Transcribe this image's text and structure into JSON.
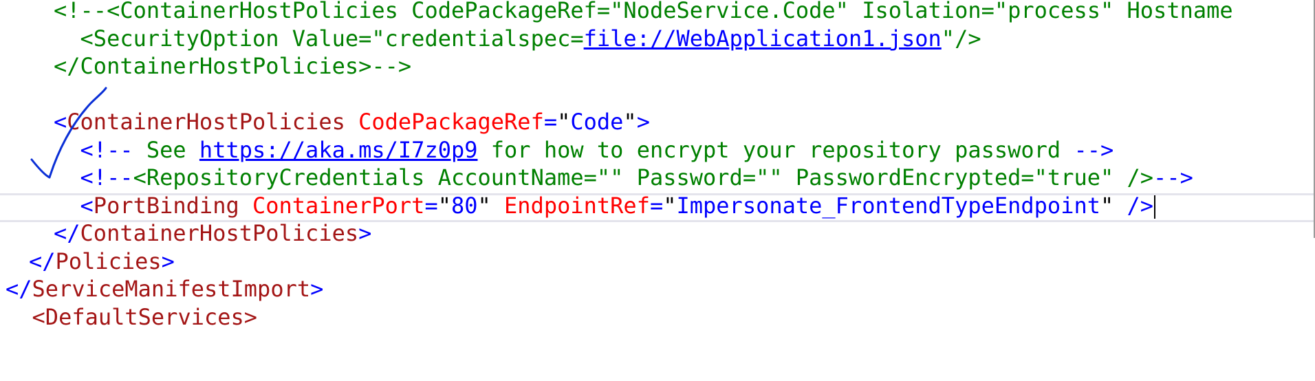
{
  "colors": {
    "delimiter": "#0000ff",
    "tag": "#a31515",
    "attribute": "#ff0000",
    "value": "#0000ff",
    "comment": "#008000",
    "link": "#0000ff",
    "current_line_border": "#e4e4ec",
    "annotation_ink": "#0a2fd6"
  },
  "annotation": {
    "icon": "handwritten-checkmark-icon"
  },
  "lines": [
    {
      "tokens": [
        {
          "t": "comment",
          "v": "<!--<ContainerHostPolicies CodePackageRef=\"NodeService.Code\" Isolation=\"process\" Hostname"
        }
      ]
    },
    {
      "tokens": [
        {
          "t": "comment",
          "v": "  <SecurityOption Value=\"credentialspec="
        },
        {
          "t": "link",
          "v": "file://WebApplication1.json"
        },
        {
          "t": "comment",
          "v": "\"/>"
        }
      ]
    },
    {
      "tokens": [
        {
          "t": "comment",
          "v": "</ContainerHostPolicies>-->"
        }
      ]
    },
    {
      "tokens": []
    },
    {
      "tokens": [
        {
          "t": "delim",
          "v": "<"
        },
        {
          "t": "tag",
          "v": "ContainerHostPolicies"
        },
        {
          "t": "text",
          "v": " "
        },
        {
          "t": "attr",
          "v": "CodePackageRef"
        },
        {
          "t": "eq",
          "v": "="
        },
        {
          "t": "quote",
          "v": "\""
        },
        {
          "t": "val",
          "v": "Code"
        },
        {
          "t": "quote",
          "v": "\""
        },
        {
          "t": "delim",
          "v": ">"
        }
      ]
    },
    {
      "tokens": [
        {
          "t": "text",
          "v": "  "
        },
        {
          "t": "delim",
          "v": "<!--"
        },
        {
          "t": "comment",
          "v": " See "
        },
        {
          "t": "link",
          "v": "https://aka.ms/I7z0p9"
        },
        {
          "t": "comment",
          "v": " for how to encrypt your repository password "
        },
        {
          "t": "delim",
          "v": "-->"
        }
      ]
    },
    {
      "tokens": [
        {
          "t": "text",
          "v": "  "
        },
        {
          "t": "delim",
          "v": "<!--"
        },
        {
          "t": "comment",
          "v": "<RepositoryCredentials AccountName=\"\" Password=\"\" PasswordEncrypted=\"true\" />"
        },
        {
          "t": "delim",
          "v": "-->"
        }
      ]
    },
    {
      "current": true,
      "caret": true,
      "tokens": [
        {
          "t": "text",
          "v": "  "
        },
        {
          "t": "delim",
          "v": "<"
        },
        {
          "t": "tag",
          "v": "PortBinding"
        },
        {
          "t": "text",
          "v": " "
        },
        {
          "t": "attr",
          "v": "ContainerPort"
        },
        {
          "t": "eq",
          "v": "="
        },
        {
          "t": "quote",
          "v": "\""
        },
        {
          "t": "val",
          "v": "80"
        },
        {
          "t": "quote",
          "v": "\""
        },
        {
          "t": "text",
          "v": " "
        },
        {
          "t": "attr",
          "v": "EndpointRef"
        },
        {
          "t": "eq",
          "v": "="
        },
        {
          "t": "quote",
          "v": "\""
        },
        {
          "t": "val",
          "v": "Impersonate_FrontendTypeEndpoint"
        },
        {
          "t": "quote",
          "v": "\""
        },
        {
          "t": "text",
          "v": " "
        },
        {
          "t": "delim",
          "v": "/>"
        }
      ]
    },
    {
      "tokens": [
        {
          "t": "delim",
          "v": "</"
        },
        {
          "t": "tag",
          "v": "ContainerHostPolicies"
        },
        {
          "t": "delim",
          "v": ">"
        }
      ]
    },
    {
      "tokens": [
        {
          "t": "delim",
          "v": "</"
        },
        {
          "t": "tag",
          "v": "Policies"
        },
        {
          "t": "delim",
          "v": ">"
        }
      ]
    },
    {
      "tokens": [
        {
          "t": "delim",
          "v": "</"
        },
        {
          "t": "tag",
          "v": "ServiceManifestImport"
        },
        {
          "t": "delim",
          "v": ">"
        }
      ]
    },
    {
      "tokens": [
        {
          "t": "tag",
          "v": "  <DefaultServices>"
        }
      ]
    }
  ]
}
